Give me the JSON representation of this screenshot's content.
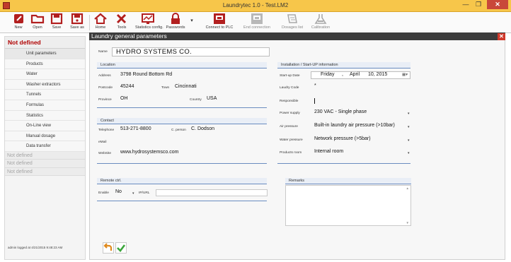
{
  "window": {
    "title": "Laundrytec 1.0 - Test.LM2",
    "min": "—",
    "max": "❐",
    "close": "✕"
  },
  "toolbar": [
    {
      "label": "New",
      "icon": "new-icon",
      "enabled": true
    },
    {
      "label": "Open",
      "icon": "folder-open-icon",
      "enabled": true
    },
    {
      "label": "Save",
      "icon": "save-icon",
      "enabled": true
    },
    {
      "label": "Save as",
      "icon": "save-as-icon",
      "enabled": true
    },
    {
      "label": "Home",
      "icon": "home-icon",
      "enabled": true
    },
    {
      "label": "Tools",
      "icon": "tools-icon",
      "enabled": true
    },
    {
      "label": "Statistics config.",
      "icon": "statistics-icon",
      "enabled": true
    },
    {
      "label": "Passwords",
      "icon": "lock-icon",
      "enabled": true
    },
    {
      "label": "Connect to PLC",
      "icon": "plc-connect-icon",
      "enabled": true
    },
    {
      "label": "End connection",
      "icon": "plc-disconnect-icon",
      "enabled": false
    },
    {
      "label": "Dosages list",
      "icon": "dosages-list-icon",
      "enabled": false
    },
    {
      "label": "Calibration",
      "icon": "flask-icon",
      "enabled": false
    }
  ],
  "sidebar": {
    "header": "Not defined",
    "items": [
      {
        "label": "Unit parameters"
      },
      {
        "label": "Products"
      },
      {
        "label": "Water"
      },
      {
        "label": "Washer extractors"
      },
      {
        "label": "Tunnels"
      },
      {
        "label": "Formulas"
      },
      {
        "label": "Statistics"
      },
      {
        "label": "On-Line view"
      },
      {
        "label": "Manual dosage"
      },
      {
        "label": "Data transfer"
      }
    ],
    "undefined_sections": [
      "Not defined",
      "Not defined",
      "Not defined"
    ],
    "footer": "admin logged at 4/21/2015 9:48:23 AM"
  },
  "panel": {
    "title": "Laundry general parameters",
    "close": "✕",
    "name_label": "Name",
    "name_value": "HYDRO SYSTEMS CO.",
    "location": {
      "group": "Location",
      "address_label": "Address",
      "address_value": "3798 Round Bottom Rd",
      "postcode_label": "Postcode",
      "postcode_value": "45244",
      "town_label": "Town",
      "town_value": "Cincinnati",
      "province_label": "Province",
      "province_value": "OH",
      "country_label": "Country",
      "country_value": "USA"
    },
    "contact": {
      "group": "Contact",
      "telephone_label": "Telephone",
      "telephone_value": "513-271-8800",
      "cperson_label": "C. person",
      "cperson_value": "C. Dodson",
      "email_label": "eMail",
      "email_value": "",
      "website_label": "WebSite",
      "website_value": "www.hydrosystemsco.com"
    },
    "installation": {
      "group": "Installation / Start-UP information",
      "startup_label": "Start-up Date",
      "startup_day": "Friday",
      "startup_sep": ",",
      "startup_month": "April",
      "startup_date": "10, 2015",
      "calendar_icon": "▦▾",
      "laundry_code_label": "Laudry Code",
      "laundry_code_value": "*",
      "responsible_label": "Responsible",
      "responsible_value": "",
      "power_label": "Power supply",
      "power_value": "230 VAC - Single phase",
      "air_label": "Air pressure",
      "air_value": "Built-in laundry air pressure (>10bar)",
      "water_label": "Water pressure",
      "water_value": "Network pressure (>5bar)",
      "products_label": "Products room",
      "products_value": "Internal room"
    },
    "remote": {
      "group": "Remote ctrl.",
      "enable_label": "Enable",
      "enable_value": "No",
      "ipurl_label": "IP/URL",
      "ipurl_value": ""
    },
    "remarks": {
      "group": "Remarks",
      "value": ""
    },
    "caret": "▾"
  }
}
